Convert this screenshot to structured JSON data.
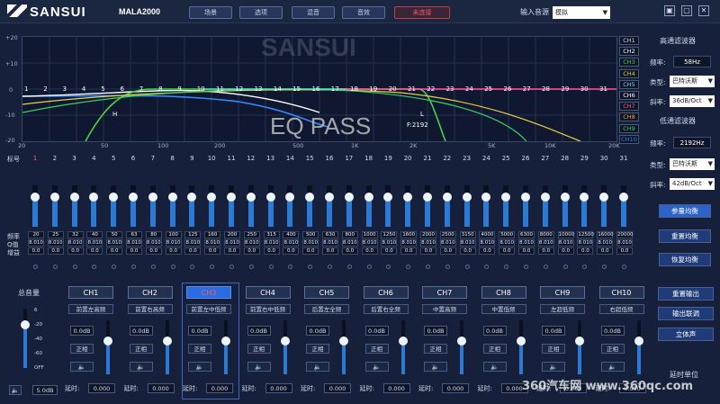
{
  "app": {
    "brand": "SANSUI",
    "model": "MALA2000"
  },
  "toolbar": {
    "buttons": [
      "场景",
      "选项",
      "混音",
      "音效"
    ],
    "status": "未连接",
    "source_label": "输入音源",
    "source_value": "模拟"
  },
  "window": {
    "minimize": "▣",
    "restore": "▢",
    "close": "✕"
  },
  "graph": {
    "yticks": [
      "+20",
      "+10",
      "0",
      "-10",
      "-20"
    ],
    "xticks": [
      "20",
      "50",
      "100",
      "200",
      "500",
      "1K",
      "2K",
      "5K",
      "10K",
      "20K"
    ],
    "band_markers": [
      "1",
      "2",
      "3",
      "4",
      "5",
      "6",
      "7",
      "8",
      "9",
      "10",
      "11",
      "12",
      "13",
      "14",
      "15",
      "16",
      "17",
      "18",
      "19",
      "20",
      "21",
      "22",
      "23",
      "24",
      "25",
      "26",
      "27",
      "28",
      "29",
      "30",
      "31"
    ],
    "h_label": "H",
    "l_label": "L",
    "freq_label": "F:2192",
    "overlay": "EQ PASS",
    "brand_watermark": "SANSUI",
    "legend": [
      {
        "label": "CH1",
        "color": "#d8d8d8"
      },
      {
        "label": "CH2",
        "color": "#ffffff"
      },
      {
        "label": "CH3",
        "color": "#4ad24a"
      },
      {
        "label": "CH4",
        "color": "#e8d040"
      },
      {
        "label": "CH5",
        "color": "#6ae0e0"
      },
      {
        "label": "CH6",
        "color": "#ffffff"
      },
      {
        "label": "CH7",
        "color": "#ff5aa0"
      },
      {
        "label": "CH8",
        "color": "#ff9a3a"
      },
      {
        "label": "CH9",
        "color": "#3ad26a"
      },
      {
        "label": "CH10",
        "color": "#3a8aff"
      }
    ]
  },
  "highpass": {
    "title": "高通滤波器",
    "freq_label": "频率:",
    "freq": "58Hz",
    "type_label": "类型:",
    "type": "巴特沃斯",
    "slope_label": "斜率:",
    "slope": "36dB/Oct"
  },
  "lowpass": {
    "title": "低通滤波器",
    "freq_label": "频率:",
    "freq": "2192Hz",
    "type_label": "类型:",
    "type": "巴特沃斯",
    "slope_label": "斜率:",
    "slope": "42dB/Oct"
  },
  "eq_buttons": {
    "param": "参量均衡",
    "reset": "重置均衡",
    "restore": "恢复均衡"
  },
  "bands": {
    "label": "标号",
    "numbers": [
      "1",
      "2",
      "3",
      "4",
      "5",
      "6",
      "7",
      "8",
      "9",
      "10",
      "11",
      "12",
      "13",
      "14",
      "15",
      "16",
      "17",
      "18",
      "19",
      "20",
      "21",
      "22",
      "23",
      "24",
      "25",
      "26",
      "27",
      "28",
      "29",
      "30",
      "31"
    ],
    "freqs": [
      "20",
      "25",
      "32",
      "40",
      "50",
      "63",
      "80",
      "100",
      "125",
      "160",
      "200",
      "250",
      "315",
      "400",
      "500",
      "630",
      "800",
      "1000",
      "1250",
      "1600",
      "2000",
      "2500",
      "3150",
      "4000",
      "5000",
      "6300",
      "8000",
      "10000",
      "12500",
      "16000",
      "20000"
    ],
    "q": "8.010",
    "gain": "0.0",
    "level": 0.5,
    "freq_label": "频率",
    "q_label": "Q值",
    "gain_label": "增益"
  },
  "master": {
    "title": "总音量",
    "ticks": [
      "6",
      "-20",
      "-40",
      "-60",
      "OFF"
    ],
    "value": "5.0dB",
    "level": 0.72
  },
  "channels": [
    {
      "name": "CH1",
      "pos": "前置左高频",
      "gain": "0.0dB",
      "phase": "正相",
      "delay": "0.000",
      "level": 0.62
    },
    {
      "name": "CH2",
      "pos": "前置右高频",
      "gain": "0.0dB",
      "phase": "正相",
      "delay": "0.000",
      "level": 0.62
    },
    {
      "name": "CH3",
      "pos": "前置左中低频",
      "gain": "0.0dB",
      "phase": "正相",
      "delay": "0.000",
      "level": 0.62
    },
    {
      "name": "CH4",
      "pos": "前置右中低频",
      "gain": "0.0dB",
      "phase": "正相",
      "delay": "0.000",
      "level": 0.62
    },
    {
      "name": "CH5",
      "pos": "后置左全频",
      "gain": "0.0dB",
      "phase": "正相",
      "delay": "0.000",
      "level": 0.62
    },
    {
      "name": "CH6",
      "pos": "后置右全频",
      "gain": "0.0dB",
      "phase": "正相",
      "delay": "0.000",
      "level": 0.62
    },
    {
      "name": "CH7",
      "pos": "中置高频",
      "gain": "0.0dB",
      "phase": "正相",
      "delay": "0.000",
      "level": 0.62
    },
    {
      "name": "CH8",
      "pos": "中置低频",
      "gain": "0.0dB",
      "phase": "正相",
      "delay": "0.000",
      "level": 0.62
    },
    {
      "name": "CH9",
      "pos": "左超低频",
      "gain": "0.0dB",
      "phase": "正相",
      "delay": "0.000",
      "level": 0.62
    },
    {
      "name": "CH10",
      "pos": "右超低频",
      "gain": "0.0dB",
      "phase": "正相",
      "delay": "0.000",
      "level": 0.62
    }
  ],
  "delay_label": "延时:",
  "mute_icon": "🔈",
  "side_buttons": {
    "reset_out": "重置输出",
    "out_link": "输出联调",
    "stereo": "立体声",
    "delay_unit": "延时单位"
  },
  "watermark": "360汽车网 www.360qc.com"
}
